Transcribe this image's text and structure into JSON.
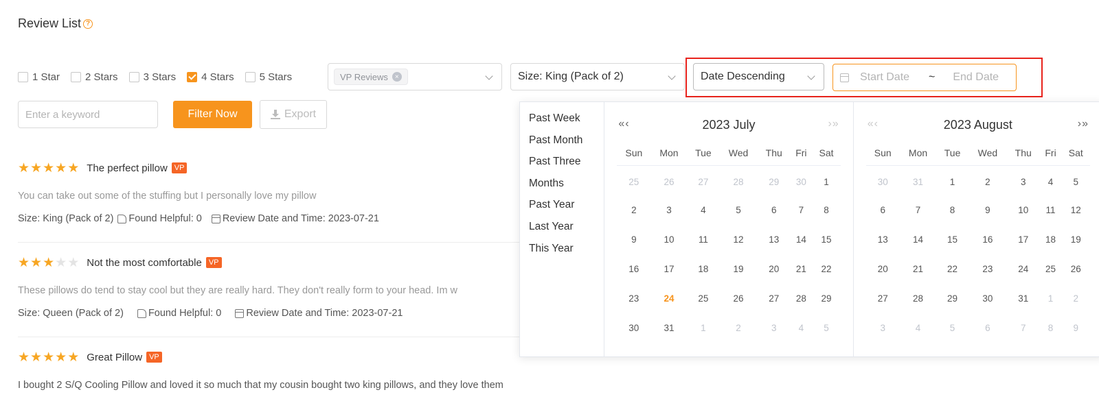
{
  "page": {
    "title": "Review List"
  },
  "filters": {
    "stars": [
      {
        "label": "1 Star",
        "checked": false
      },
      {
        "label": "2 Stars",
        "checked": false
      },
      {
        "label": "3 Stars",
        "checked": false
      },
      {
        "label": "4 Stars",
        "checked": true
      },
      {
        "label": "5 Stars",
        "checked": false
      }
    ],
    "review_type_tag": "VP Reviews",
    "size_select": "Size: King (Pack of 2)",
    "sort_select": "Date Descending",
    "start_placeholder": "Start Date",
    "separator": "~",
    "end_placeholder": "End Date",
    "keyword_placeholder": "Enter a keyword",
    "filter_button": "Filter Now",
    "export_button": "Export"
  },
  "reviews": [
    {
      "rating": 5,
      "title": "The perfect pillow",
      "badge": "VP",
      "body": "You can take out some of the stuffing but I personally love my pillow",
      "size": "Size: King (Pack of 2)",
      "helpful": "Found Helpful: 0",
      "date": "Review Date and Time: 2023-07-21"
    },
    {
      "rating": 3,
      "title": "Not the most comfortable",
      "badge": "VP",
      "body": "These pillows do tend to stay cool but they are really hard. They don't really form to your head. Im w",
      "size": "Size: Queen (Pack of 2)",
      "helpful": "Found Helpful: 0",
      "date": "Review Date and Time: 2023-07-21"
    },
    {
      "rating": 5,
      "title": "Great Pillow",
      "badge": "VP",
      "body": " I bought 2 S/Q Cooling Pillow and loved it so much that my cousin bought two king pillows, and they love them",
      "size": "",
      "helpful": "",
      "date": ""
    }
  ],
  "datepicker": {
    "shortcuts": [
      "Past Week",
      "Past Month",
      "Past Three",
      "Months",
      "Past Year",
      "Last Year",
      "This Year"
    ],
    "weekdays": [
      "Sun",
      "Mon",
      "Tue",
      "Wed",
      "Thu",
      "Fri",
      "Sat"
    ],
    "left": {
      "title": "2023 July",
      "nav_prev": "«‹",
      "nav_next": "›»",
      "weeks": [
        [
          [
            "25",
            1
          ],
          [
            "26",
            1
          ],
          [
            "27",
            1
          ],
          [
            "28",
            1
          ],
          [
            "29",
            1
          ],
          [
            "30",
            1
          ],
          [
            "1",
            0
          ]
        ],
        [
          [
            "2",
            0
          ],
          [
            "3",
            0
          ],
          [
            "4",
            0
          ],
          [
            "5",
            0
          ],
          [
            "6",
            0
          ],
          [
            "7",
            0
          ],
          [
            "8",
            0
          ]
        ],
        [
          [
            "9",
            0
          ],
          [
            "10",
            0
          ],
          [
            "11",
            0
          ],
          [
            "12",
            0
          ],
          [
            "13",
            0
          ],
          [
            "14",
            0
          ],
          [
            "15",
            0
          ]
        ],
        [
          [
            "16",
            0
          ],
          [
            "17",
            0
          ],
          [
            "18",
            0
          ],
          [
            "19",
            0
          ],
          [
            "20",
            0
          ],
          [
            "21",
            0
          ],
          [
            "22",
            0
          ]
        ],
        [
          [
            "23",
            0
          ],
          [
            "24",
            2
          ],
          [
            "25",
            0
          ],
          [
            "26",
            0
          ],
          [
            "27",
            0
          ],
          [
            "28",
            0
          ],
          [
            "29",
            0
          ]
        ],
        [
          [
            "30",
            0
          ],
          [
            "31",
            0
          ],
          [
            "1",
            1
          ],
          [
            "2",
            1
          ],
          [
            "3",
            1
          ],
          [
            "4",
            1
          ],
          [
            "5",
            1
          ]
        ]
      ]
    },
    "right": {
      "title": "2023 August",
      "nav_prev": "«‹",
      "nav_next": "›»",
      "weeks": [
        [
          [
            "30",
            1
          ],
          [
            "31",
            1
          ],
          [
            "1",
            0
          ],
          [
            "2",
            0
          ],
          [
            "3",
            0
          ],
          [
            "4",
            0
          ],
          [
            "5",
            0
          ]
        ],
        [
          [
            "6",
            0
          ],
          [
            "7",
            0
          ],
          [
            "8",
            0
          ],
          [
            "9",
            0
          ],
          [
            "10",
            0
          ],
          [
            "11",
            0
          ],
          [
            "12",
            0
          ]
        ],
        [
          [
            "13",
            0
          ],
          [
            "14",
            0
          ],
          [
            "15",
            0
          ],
          [
            "16",
            0
          ],
          [
            "17",
            0
          ],
          [
            "18",
            0
          ],
          [
            "19",
            0
          ]
        ],
        [
          [
            "20",
            0
          ],
          [
            "21",
            0
          ],
          [
            "22",
            0
          ],
          [
            "23",
            0
          ],
          [
            "24",
            0
          ],
          [
            "25",
            0
          ],
          [
            "26",
            0
          ]
        ],
        [
          [
            "27",
            0
          ],
          [
            "28",
            0
          ],
          [
            "29",
            0
          ],
          [
            "30",
            0
          ],
          [
            "31",
            0
          ],
          [
            "1",
            1
          ],
          [
            "2",
            1
          ]
        ],
        [
          [
            "3",
            1
          ],
          [
            "4",
            1
          ],
          [
            "5",
            1
          ],
          [
            "6",
            1
          ],
          [
            "7",
            1
          ],
          [
            "8",
            1
          ],
          [
            "9",
            1
          ]
        ]
      ]
    }
  },
  "colors": {
    "accent": "#f7941d",
    "highlight": "#e8231c",
    "badge": "#f56526",
    "star": "#f7a623"
  }
}
